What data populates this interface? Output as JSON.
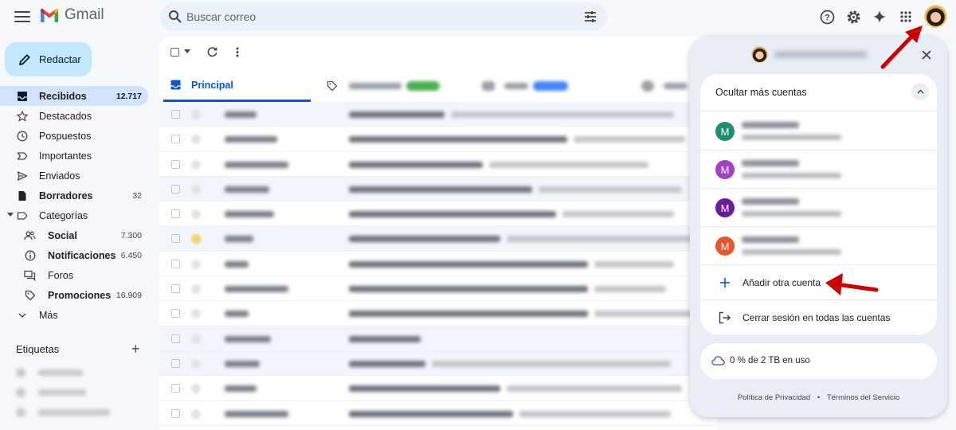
{
  "app": {
    "name": "Gmail",
    "search_placeholder": "Buscar correo"
  },
  "sidebar": {
    "compose_label": "Redactar",
    "items": [
      {
        "label": "Recibidos",
        "count": "12.717"
      },
      {
        "label": "Destacados",
        "count": ""
      },
      {
        "label": "Pospuestos",
        "count": ""
      },
      {
        "label": "Importantes",
        "count": ""
      },
      {
        "label": "Enviados",
        "count": ""
      },
      {
        "label": "Borradores",
        "count": "32"
      },
      {
        "label": "Categorías",
        "count": ""
      },
      {
        "label": "Social",
        "count": "7.300"
      },
      {
        "label": "Notificaciones",
        "count": "6.450"
      },
      {
        "label": "Foros",
        "count": ""
      },
      {
        "label": "Promociones",
        "count": "16.909"
      },
      {
        "label": "Más",
        "count": ""
      }
    ],
    "labels_title": "Etiquetas",
    "labels_add": "+"
  },
  "main": {
    "tabs": [
      {
        "label": "Principal"
      }
    ]
  },
  "account_panel": {
    "hide_accounts_label": "Ocultar más cuentas",
    "accounts": [
      {
        "initial": "M",
        "color": "#1e8e6e"
      },
      {
        "initial": "M",
        "color": "#a142c5"
      },
      {
        "initial": "M",
        "color": "#6a1b9a"
      },
      {
        "initial": "M",
        "color": "#e8552b"
      }
    ],
    "add_account_label": "Añadir otra cuenta",
    "sign_out_label": "Cerrar sesión en todas las cuentas",
    "storage_label": "0 % de 2 TB en uso",
    "privacy_label": "Política de Privacidad",
    "separator": "•",
    "terms_label": "Términos del Servicio"
  },
  "colors": {
    "accent": "#0b57d0",
    "compose_bg": "#c2e7ff",
    "active_nav_bg": "#d3e3fd",
    "annotation_arrow": "#cc0000"
  }
}
